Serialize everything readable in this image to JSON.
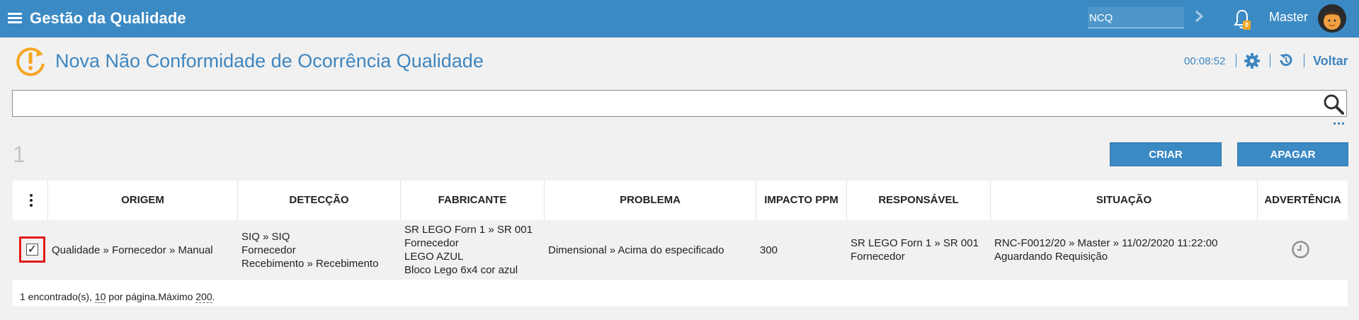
{
  "topbar": {
    "app_title": "Gestão da Qualidade",
    "module_value": "NCQ",
    "notification_count": "0",
    "user_name": "Master"
  },
  "page": {
    "title": "Nova Não Conformidade de Ocorrência Qualidade",
    "timer": "00:08:52",
    "back_label": "Voltar"
  },
  "search": {
    "value": "",
    "placeholder": ""
  },
  "results": {
    "count": "1",
    "create_label": "CRIAR",
    "delete_label": "APAGAR"
  },
  "table": {
    "columns": {
      "origem": "ORIGEM",
      "deteccao": "DETECÇÃO",
      "fabricante": "FABRICANTE",
      "problema": "PROBLEMA",
      "impacto": "IMPACTO PPM",
      "responsavel": "RESPONSÁVEL",
      "situacao": "SITUAÇÃO",
      "advertencia": "ADVERTÊNCIA"
    },
    "rows": [
      {
        "checked": "✓",
        "origem": "Qualidade » Fornecedor » Manual",
        "deteccao": [
          "SIQ » SIQ",
          "Fornecedor",
          "Recebimento » Recebimento"
        ],
        "fabricante": [
          "SR LEGO Forn 1 » SR 001",
          "Fornecedor",
          "LEGO AZUL",
          "Bloco Lego 6x4 cor azul"
        ],
        "problema": "Dimensional » Acima do especificado",
        "impacto": "300",
        "responsavel": [
          "SR LEGO Forn 1 » SR 001",
          "Fornecedor"
        ],
        "situacao": [
          "RNC-F0012/20 » Master » 11/02/2020 11:22:00",
          "Aguardando Requisição"
        ],
        "advertencia_icon": "clock-icon"
      }
    ],
    "footer": {
      "found_prefix": "1 encontrado(s), ",
      "per_page": "10",
      "per_page_suffix": " por página.Máximo ",
      "max": "200",
      "end": "."
    }
  },
  "colors": {
    "topbar": "#3b8ac4",
    "title": "#3f86c0",
    "warning_icon": "#f5a623",
    "checkbox_highlight": "#e21b1b"
  }
}
